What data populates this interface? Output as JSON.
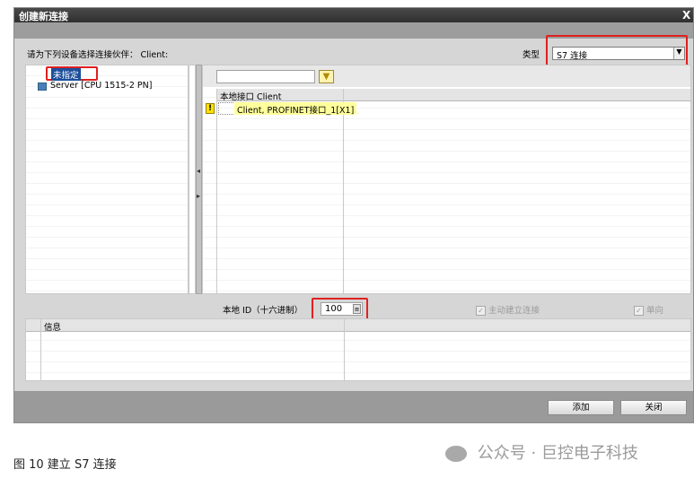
{
  "dialog": {
    "title": "创建新连接",
    "close_glyph": "X",
    "prompt_label": "请为下列设备选择连接伙伴： Client:",
    "type_label": "类型",
    "type_value": "S7 连接",
    "tree": [
      {
        "label": "未指定",
        "selected": true
      },
      {
        "label": "Server [CPU 1515-2 PN]",
        "selected": false
      }
    ],
    "filter_input_value": "",
    "table": {
      "header": "本地接口 Client",
      "rows": [
        {
          "status": "warning",
          "value": "Client, PROFINET接口_1[X1]"
        }
      ]
    },
    "local_id_label": "本地 ID（十六进制）",
    "local_id_value": "100",
    "checkbox_active": {
      "label": "主动建立连接",
      "checked": true,
      "enabled": false
    },
    "checkbox_oneway": {
      "label": "单向",
      "checked": true,
      "enabled": false
    },
    "info_header": "信息",
    "buttons": {
      "add": "添加",
      "close": "关闭"
    }
  },
  "caption": "图 10 建立 S7 连接",
  "watermark": "公众号 · 巨控电子科技",
  "colors": {
    "highlight_red": "#e02020",
    "selection_blue": "#1c4f9c",
    "warning_yellow": "#ffff9c"
  }
}
